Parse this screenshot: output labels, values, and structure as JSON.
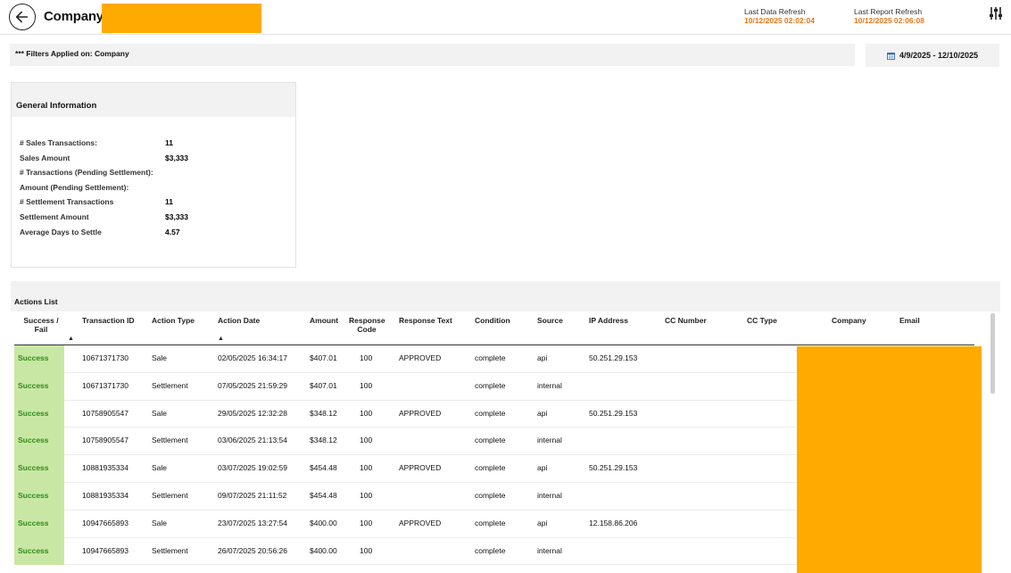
{
  "header": {
    "company_label": "Company:",
    "last_data_refresh_label": "Last Data Refresh",
    "last_data_refresh_value": "10/12/2025 02:02:04",
    "last_report_refresh_label": "Last Report Refresh",
    "last_report_refresh_value": "10/12/2025 02:06:08"
  },
  "filters": {
    "text": "*** Filters Applied on: Company",
    "date_range": "4/9/2025 - 12/10/2025"
  },
  "general_info": {
    "title": "General Information",
    "rows": [
      {
        "label": "# Sales Transactions:",
        "value": "11"
      },
      {
        "label": "Sales Amount",
        "value": "$3,333"
      },
      {
        "label": "# Transactions (Pending Settlement):",
        "value": ""
      },
      {
        "label": "Amount (Pending Settlement):",
        "value": ""
      },
      {
        "label": "# Settlement Transactions",
        "value": "11"
      },
      {
        "label": "Settlement Amount",
        "value": "$3,333"
      },
      {
        "label": "Average Days to Settle",
        "value": "4.57"
      }
    ]
  },
  "actions": {
    "title": "Actions List",
    "columns": [
      "Success / Fail",
      "Transaction ID",
      "Action Type",
      "Action Date",
      "Amount",
      "Response Code",
      "Response Text",
      "Condition",
      "Source",
      "IP Address",
      "CC Number",
      "CC Type",
      "Company",
      "Email"
    ],
    "rows": [
      {
        "status": "Success",
        "txn": "10671371730",
        "type": "Sale",
        "date": "02/05/2025 16:34:17",
        "amount": "$407.01",
        "code": "100",
        "resp": "APPROVED",
        "cond": "complete",
        "source": "api",
        "ip": "50.251.29.153"
      },
      {
        "status": "Success",
        "txn": "10671371730",
        "type": "Settlement",
        "date": "07/05/2025 21:59:29",
        "amount": "$407.01",
        "code": "100",
        "resp": "",
        "cond": "complete",
        "source": "internal",
        "ip": ""
      },
      {
        "status": "Success",
        "txn": "10758905547",
        "type": "Sale",
        "date": "29/05/2025 12:32:28",
        "amount": "$348.12",
        "code": "100",
        "resp": "APPROVED",
        "cond": "complete",
        "source": "api",
        "ip": "50.251.29.153"
      },
      {
        "status": "Success",
        "txn": "10758905547",
        "type": "Settlement",
        "date": "03/06/2025 21:13:54",
        "amount": "$348.12",
        "code": "100",
        "resp": "",
        "cond": "complete",
        "source": "internal",
        "ip": ""
      },
      {
        "status": "Success",
        "txn": "10881935334",
        "type": "Sale",
        "date": "03/07/2025 19:02:59",
        "amount": "$454.48",
        "code": "100",
        "resp": "APPROVED",
        "cond": "complete",
        "source": "api",
        "ip": "50.251.29.153"
      },
      {
        "status": "Success",
        "txn": "10881935334",
        "type": "Settlement",
        "date": "09/07/2025 21:11:52",
        "amount": "$454.48",
        "code": "100",
        "resp": "",
        "cond": "complete",
        "source": "internal",
        "ip": ""
      },
      {
        "status": "Success",
        "txn": "10947665893",
        "type": "Sale",
        "date": "23/07/2025 13:27:54",
        "amount": "$400.00",
        "code": "100",
        "resp": "APPROVED",
        "cond": "complete",
        "source": "api",
        "ip": "12.158.86.206"
      },
      {
        "status": "Success",
        "txn": "10947665893",
        "type": "Settlement",
        "date": "26/07/2025 20:56:26",
        "amount": "$400.00",
        "code": "100",
        "resp": "",
        "cond": "complete",
        "source": "internal",
        "ip": ""
      }
    ]
  },
  "colors": {
    "accent_orange": "#E8781E",
    "redaction": "#FFAA00",
    "success_bg": "#C9E7A4",
    "success_text": "#2E8B1A"
  },
  "icons": [
    "back-arrow-icon",
    "settings-sliders-icon",
    "calendar-icon",
    "sort-ascending-icon"
  ]
}
